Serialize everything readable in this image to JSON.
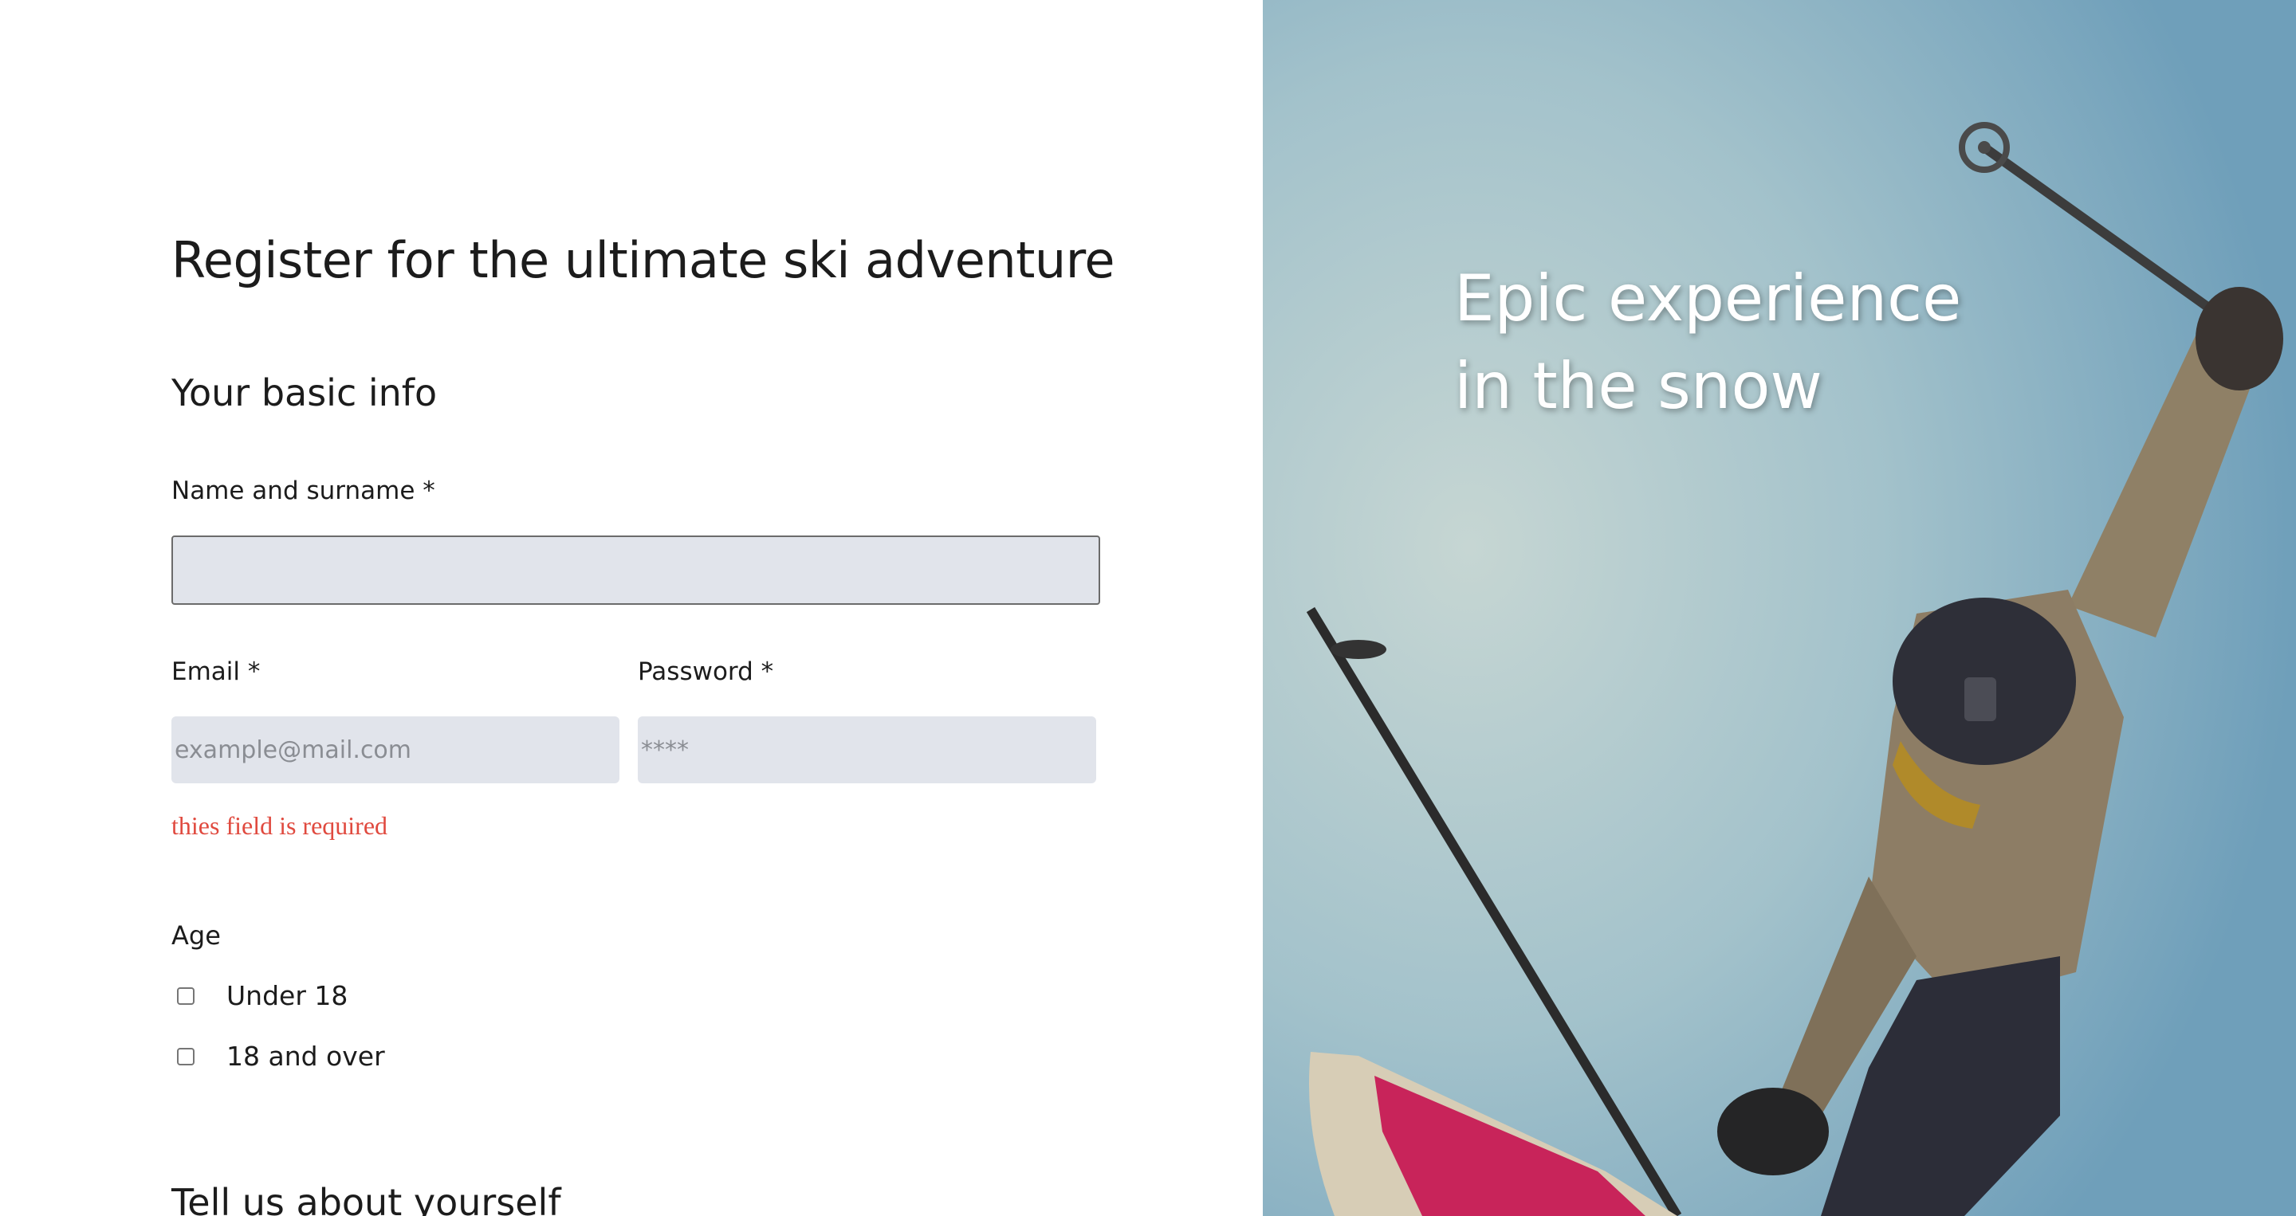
{
  "form": {
    "title": "Register for the ultimate ski adventure",
    "basic_info_heading": "Your basic info",
    "name_label": "Name and surname *",
    "name_value": "",
    "email_label": "Email *",
    "email_placeholder": "example@mail.com",
    "password_label": "Password *",
    "password_placeholder": "****",
    "error_message": "thies field is required",
    "age_label": "Age",
    "age_options": [
      {
        "label": "Under 18",
        "checked": false
      },
      {
        "label": "18 and over",
        "checked": false
      }
    ],
    "about_heading": "Tell us about yourself"
  },
  "hero": {
    "headline_line1": "Epic experience",
    "headline_line2": "in the snow",
    "image_subject": "skier-jumping-photo"
  },
  "colors": {
    "error": "#e04a3f",
    "input_background": "#e1e4eb",
    "hero_text": "#ffffff"
  }
}
